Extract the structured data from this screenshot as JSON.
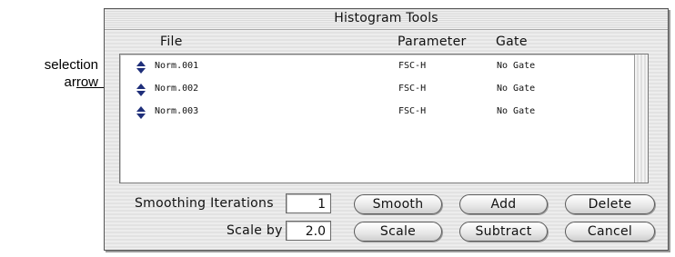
{
  "annotation": {
    "line1": "selection",
    "line2": "arrow"
  },
  "window": {
    "title": "Histogram Tools"
  },
  "list": {
    "columns": [
      "File",
      "Parameter",
      "Gate"
    ],
    "rows": [
      {
        "file": "Norm.001",
        "parameter": "FSC-H",
        "gate": "No Gate",
        "icon": "selection-arrow-icon"
      },
      {
        "file": "Norm.002",
        "parameter": "FSC-H",
        "gate": "No Gate",
        "icon": "selection-arrow-icon"
      },
      {
        "file": "Norm.003",
        "parameter": "FSC-H",
        "gate": "No Gate",
        "icon": "selection-arrow-icon"
      }
    ]
  },
  "controls": {
    "smoothing_label": "Smoothing Iterations",
    "smoothing_value": "1",
    "scale_label": "Scale by",
    "scale_value": "2.0"
  },
  "buttons": {
    "smooth": "Smooth",
    "add": "Add",
    "delete": "Delete",
    "scale": "Scale",
    "subtract": "Subtract",
    "cancel": "Cancel"
  }
}
